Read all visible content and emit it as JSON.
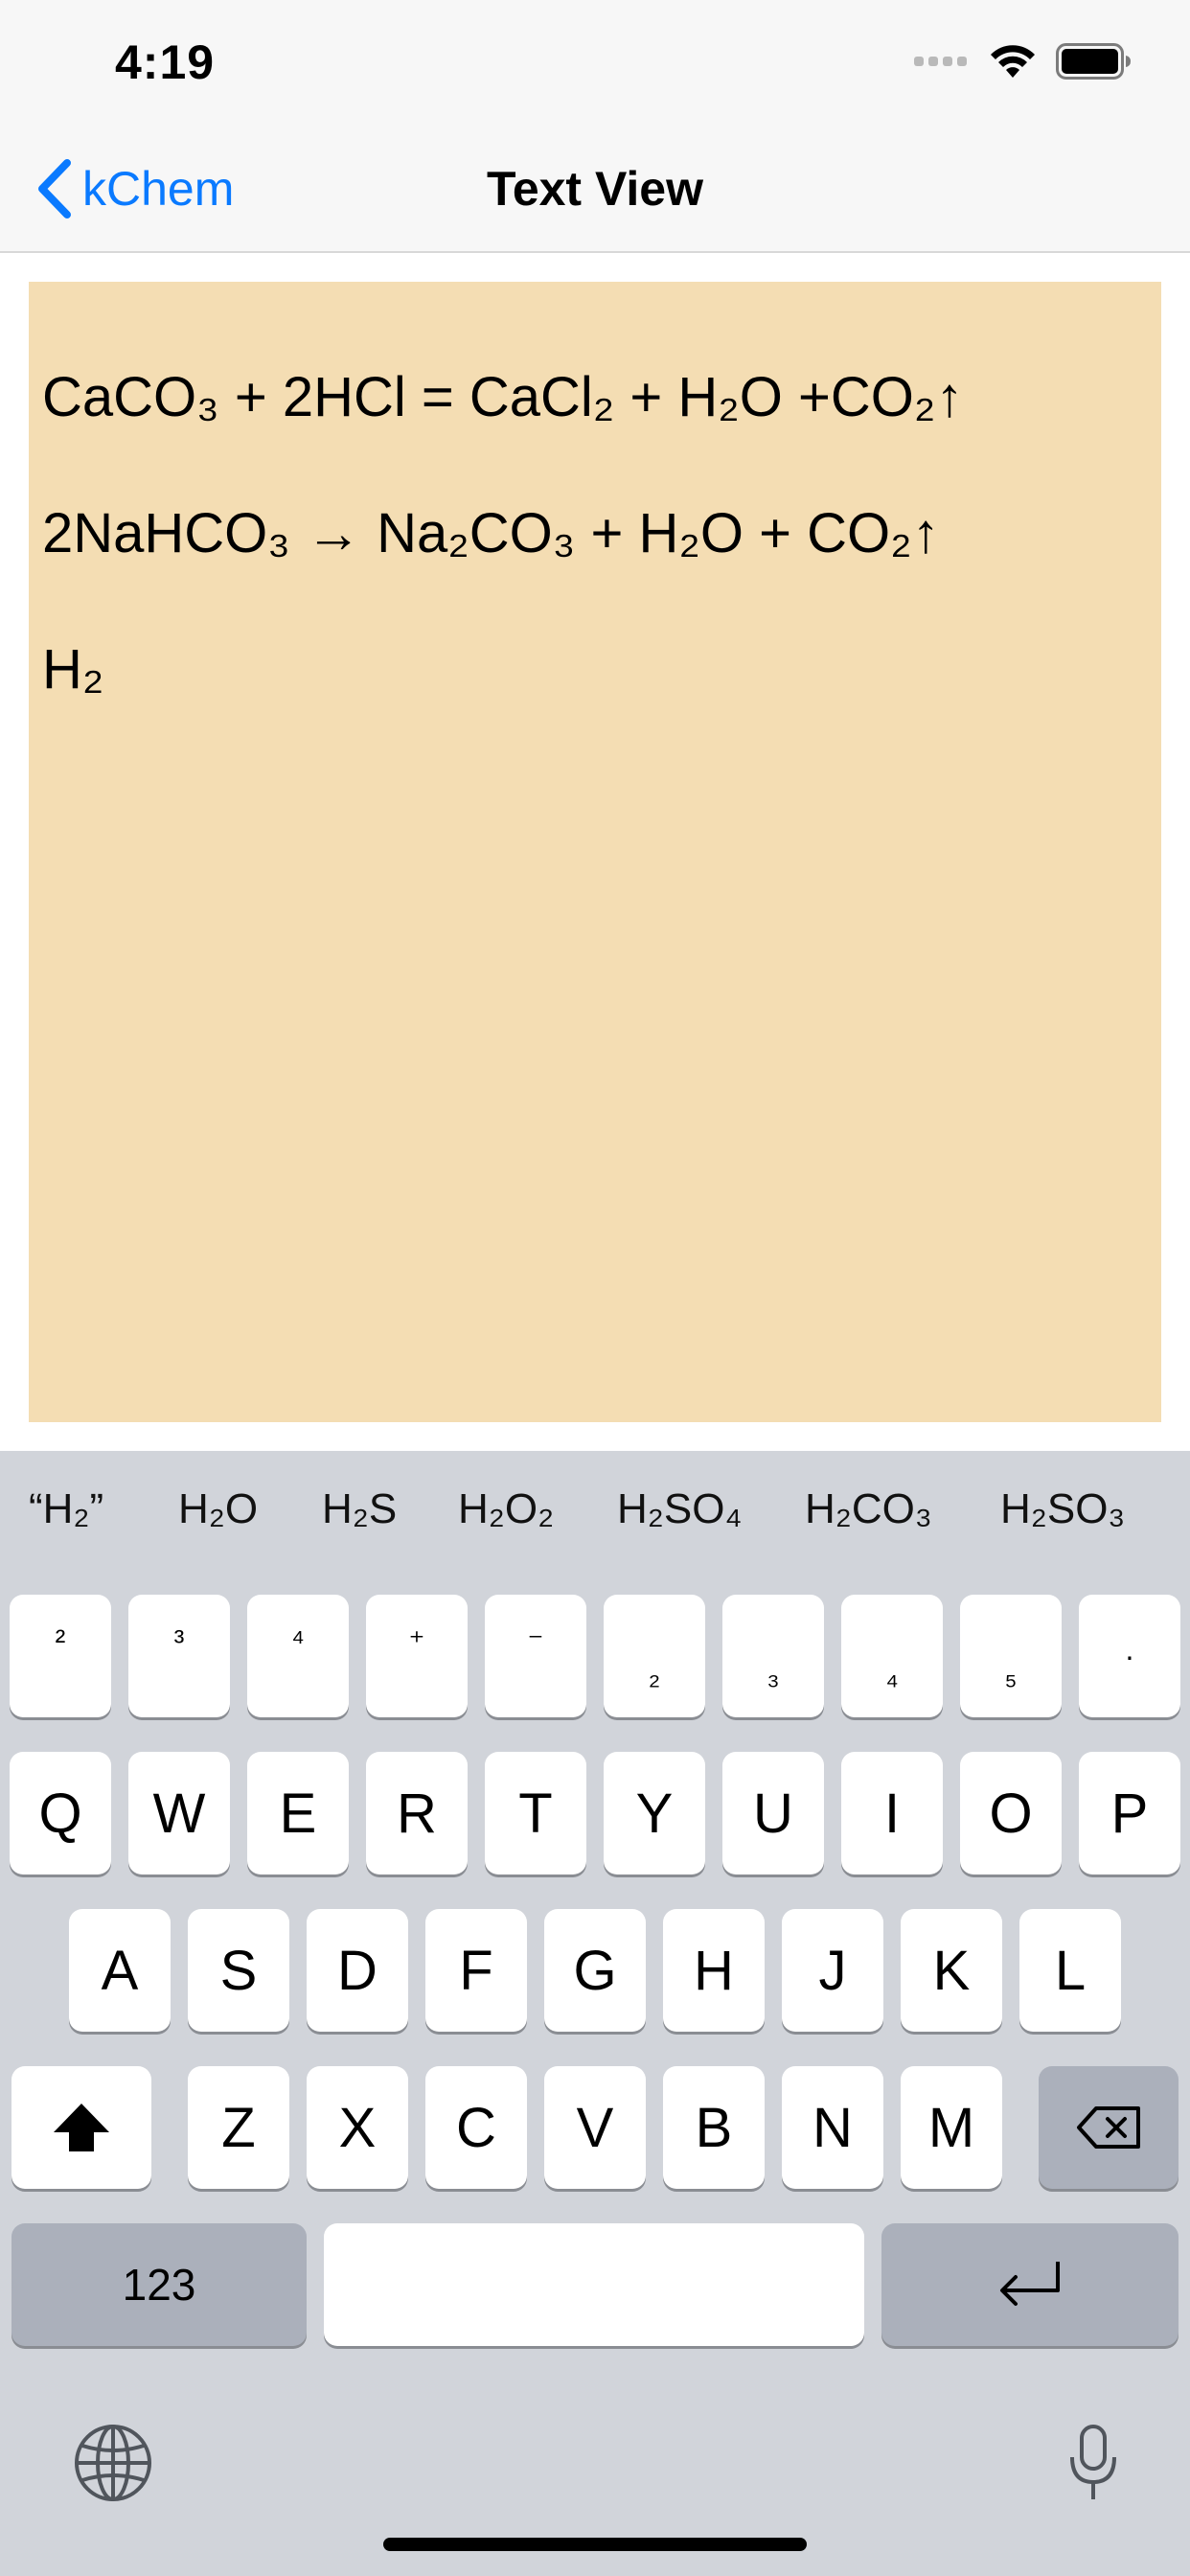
{
  "status": {
    "time": "4:19"
  },
  "nav": {
    "back_label": "kChem",
    "title": "Text View"
  },
  "textview": {
    "lines": [
      "CaCO₃ + 2HCl = CaCl₂ + H₂O +CO₂↑",
      "2NaHCO₃ → Na₂CO₃ + H₂O + CO₂↑",
      "H₂"
    ],
    "background": "#f4ddb3"
  },
  "keyboard": {
    "suggestions": [
      "“H₂”",
      "H₂O",
      "H₂S",
      "H₂O₂",
      "H₂SO₄",
      "H₂CO₃",
      "H₂SO₃"
    ],
    "chem_row": [
      "²",
      "³",
      "⁴",
      "⁺",
      "⁻",
      "₂",
      "₃",
      "₄",
      "₅",
      "·"
    ],
    "row1": [
      "Q",
      "W",
      "E",
      "R",
      "T",
      "Y",
      "U",
      "I",
      "O",
      "P"
    ],
    "row2": [
      "A",
      "S",
      "D",
      "F",
      "G",
      "H",
      "J",
      "K",
      "L"
    ],
    "row3": [
      "Z",
      "X",
      "C",
      "V",
      "B",
      "N",
      "M"
    ],
    "numbers_label": "123",
    "shift_icon": "shift-filled-icon",
    "delete_icon": "delete-backspace-icon",
    "return_icon": "return-arrow-icon",
    "globe_icon": "globe-icon",
    "mic_icon": "microphone-icon"
  },
  "colors": {
    "accent": "#0a7aff",
    "keyboard_bg": "#d1d4da",
    "key_dark": "#abb0bb"
  }
}
